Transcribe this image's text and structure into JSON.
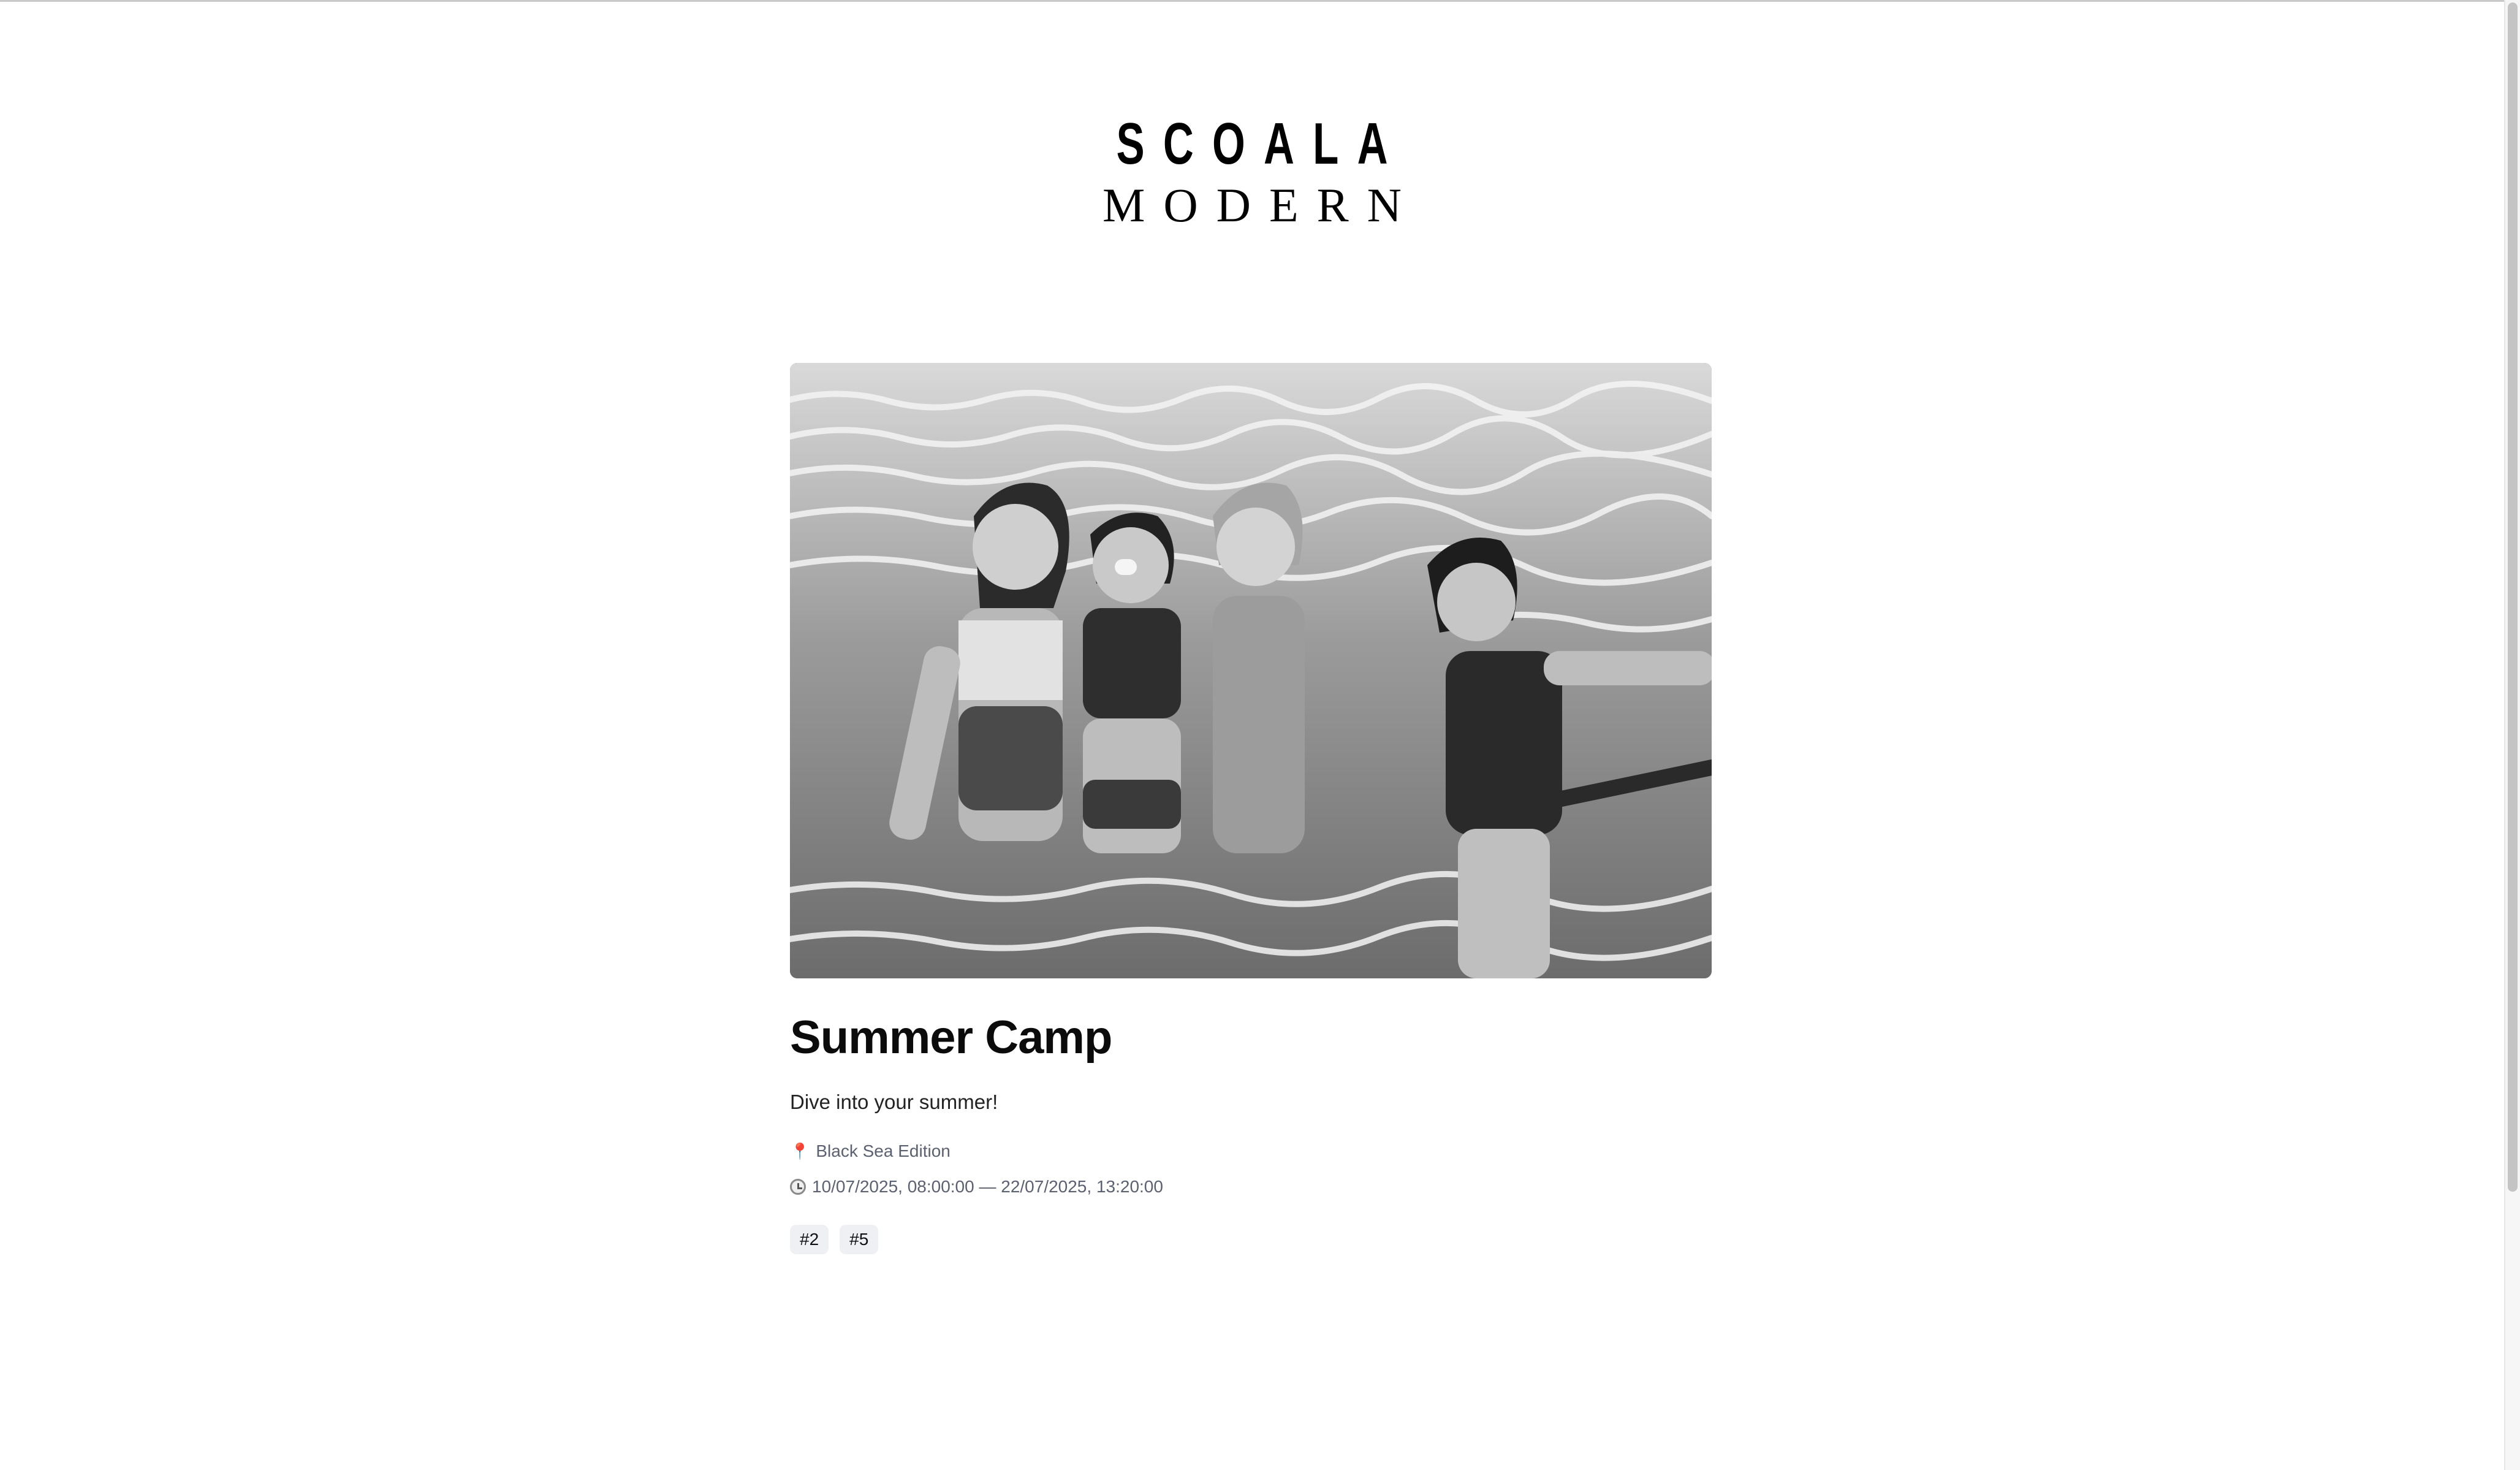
{
  "brand": {
    "line1": "SCOALA",
    "line2": "MODERN"
  },
  "event": {
    "image_alt": "Four girls in swimsuits smiling in a pool",
    "title": "Summer Camp",
    "subtitle": "Dive into your summer!",
    "location": "Black Sea Edition",
    "datetime": "10/07/2025, 08:00:00 — 22/07/2025, 13:20:00",
    "tags": [
      "#2",
      "#5"
    ]
  },
  "icons": {
    "location": "pin-icon",
    "time": "clock-icon"
  }
}
